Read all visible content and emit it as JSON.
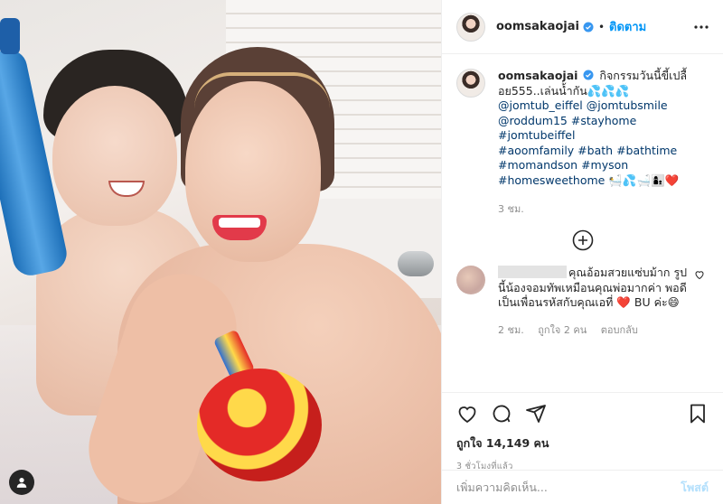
{
  "header": {
    "username": "oomsakaojai",
    "separator": "•",
    "follow_label": "ติดตาม"
  },
  "caption": {
    "username": "oomsakaojai",
    "text_line1": "กิจกรรมวันนี้ขี้เปลื้อย555..เล่นน้ำกัน💦💦💦",
    "tags": [
      "@jomtub_eiffel",
      "@jomtubsmile",
      "@roddum15",
      "#stayhome",
      "#jomtubeiffel",
      "#aoomfamily",
      "#bath",
      "#bathtime",
      "#momandson",
      "#myson",
      "#homesweethome"
    ],
    "emoji_tail": "🛀💦🛁👩‍👦❤️",
    "age": "3 ชม."
  },
  "comment": {
    "text": "คุณอ้อมสวยแซ่บม้าก รูปนี้น้องจอมทัพเหมือนคุณพ่อมากค่า พอดีเป็นเพื่อนรหัสกับคุณเอที่ ",
    "text_tail": " BU ค่ะ😄",
    "heart": "❤️",
    "age": "2 ชม.",
    "likes": "ถูกใจ 2 คน",
    "reply_label": "ตอบกลับ"
  },
  "post": {
    "likes_label": "ถูกใจ 14,149 คน",
    "timestamp": "3 ชั่วโมงที่แล้ว"
  },
  "add_comment": {
    "placeholder": "เพิ่มความคิดเห็น...",
    "post_label": "โพสต์"
  },
  "colors": {
    "accent": "#0095f6",
    "tag": "#00376b",
    "muted": "#8e8e8e",
    "heart": "#ed4956"
  }
}
